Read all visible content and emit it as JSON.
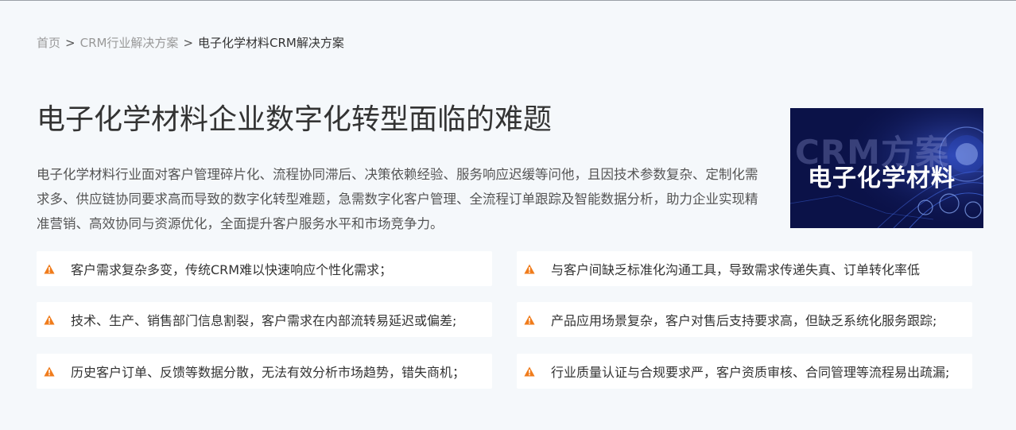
{
  "breadcrumb": {
    "home": "首页",
    "separator": ">",
    "category": "CRM行业解决方案",
    "current": "电子化学材料CRM解决方案"
  },
  "main": {
    "title": "电子化学材料企业数字化转型面临的难题",
    "description": "电子化学材料行业面对客户管理碎片化、流程协同滞后、决策依赖经验、服务响应迟缓等问他，且因技术参数复杂、定制化需求多、供应链协同要求高而导致的数字化转型难题，急需数字化客户管理、全流程订单跟踪及智能数据分析，助力企业实现精准营销、高效协同与资源优化，全面提升客户服务水平和市场竞争力。"
  },
  "hero_image": {
    "background_text": "CRM方案",
    "foreground_text": "电子化学材料"
  },
  "issues": [
    {
      "icon": "warning-icon",
      "text": "客户需求复杂多变，传统CRM难以快速响应个性化需求；"
    },
    {
      "icon": "warning-icon",
      "text": "与客户间缺乏标准化沟通工具，导致需求传递失真、订单转化率低"
    },
    {
      "icon": "warning-icon",
      "text": "技术、生产、销售部门信息割裂，客户需求在内部流转易延迟或偏差;"
    },
    {
      "icon": "warning-icon",
      "text": "产品应用场景复杂，客户对售后支持要求高，但缺乏系统化服务跟踪;"
    },
    {
      "icon": "warning-icon",
      "text": "历史客户订单、反馈等数据分散，无法有效分析市场趋势，错失商机；"
    },
    {
      "icon": "warning-icon",
      "text": "行业质量认证与合规要求严，客户资质审核、合同管理等流程易出疏漏;"
    }
  ],
  "colors": {
    "warning": "#f07c1c",
    "page_background": "#f5f8fb",
    "card_background": "#ffffff",
    "hero_background": "#0c1450"
  }
}
